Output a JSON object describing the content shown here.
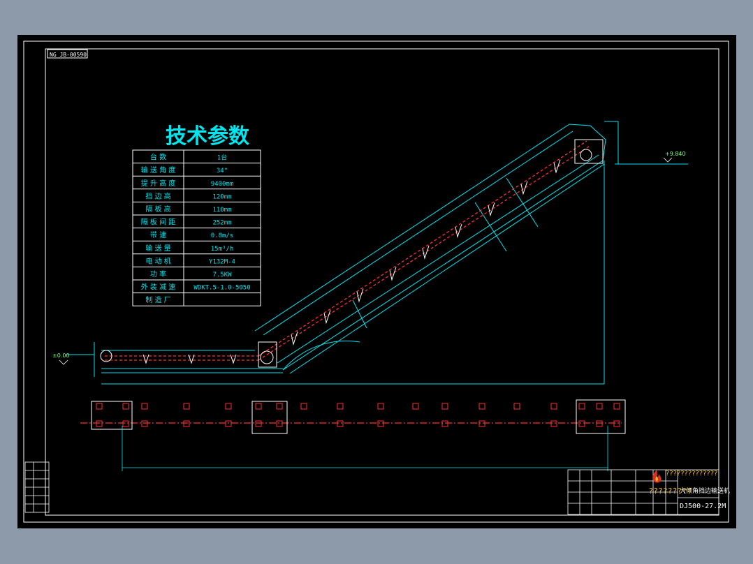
{
  "colors": {
    "background": "#8d9aaa",
    "canvas": "#000000",
    "line_white": "#ffffff",
    "line_cyan": "#00e5ee",
    "line_red": "#ff3030",
    "dim_green": "#7fff7f",
    "watermark": "#f0c020"
  },
  "drawing": {
    "code_box": "NG JB-00590",
    "title": "技术参数"
  },
  "params_table": {
    "rows": [
      {
        "label": "台 数",
        "value": "1台"
      },
      {
        "label": "输 送 角 度",
        "value": "34°"
      },
      {
        "label": "提 升 高 度",
        "value": "9400mm"
      },
      {
        "label": "挡 边 高",
        "value": "120mm"
      },
      {
        "label": "隔 板 高",
        "value": "110mm"
      },
      {
        "label": "隔 板 间 距",
        "value": "252mm"
      },
      {
        "label": "带 速",
        "value": "0.8m/s"
      },
      {
        "label": "输 送 量",
        "value": "15m³/h"
      },
      {
        "label": "电 动 机",
        "value": "Y132M-4"
      },
      {
        "label": "功 率",
        "value": "7.5KW"
      },
      {
        "label": "外 装 减 速",
        "value": "WDKT.5-1.0-5050"
      },
      {
        "label": "制 造 厂",
        "value": ""
      }
    ]
  },
  "elevations": {
    "top": "+9.840",
    "base": "±0.00"
  },
  "title_block": {
    "product_name": "大倾角挡边输送机",
    "drawing_no": "DJ500-27.2M"
  },
  "watermark": {
    "line1": "??????????????",
    "line2": "?????????"
  },
  "icons": {
    "watermark_logo": "flame-icon"
  }
}
